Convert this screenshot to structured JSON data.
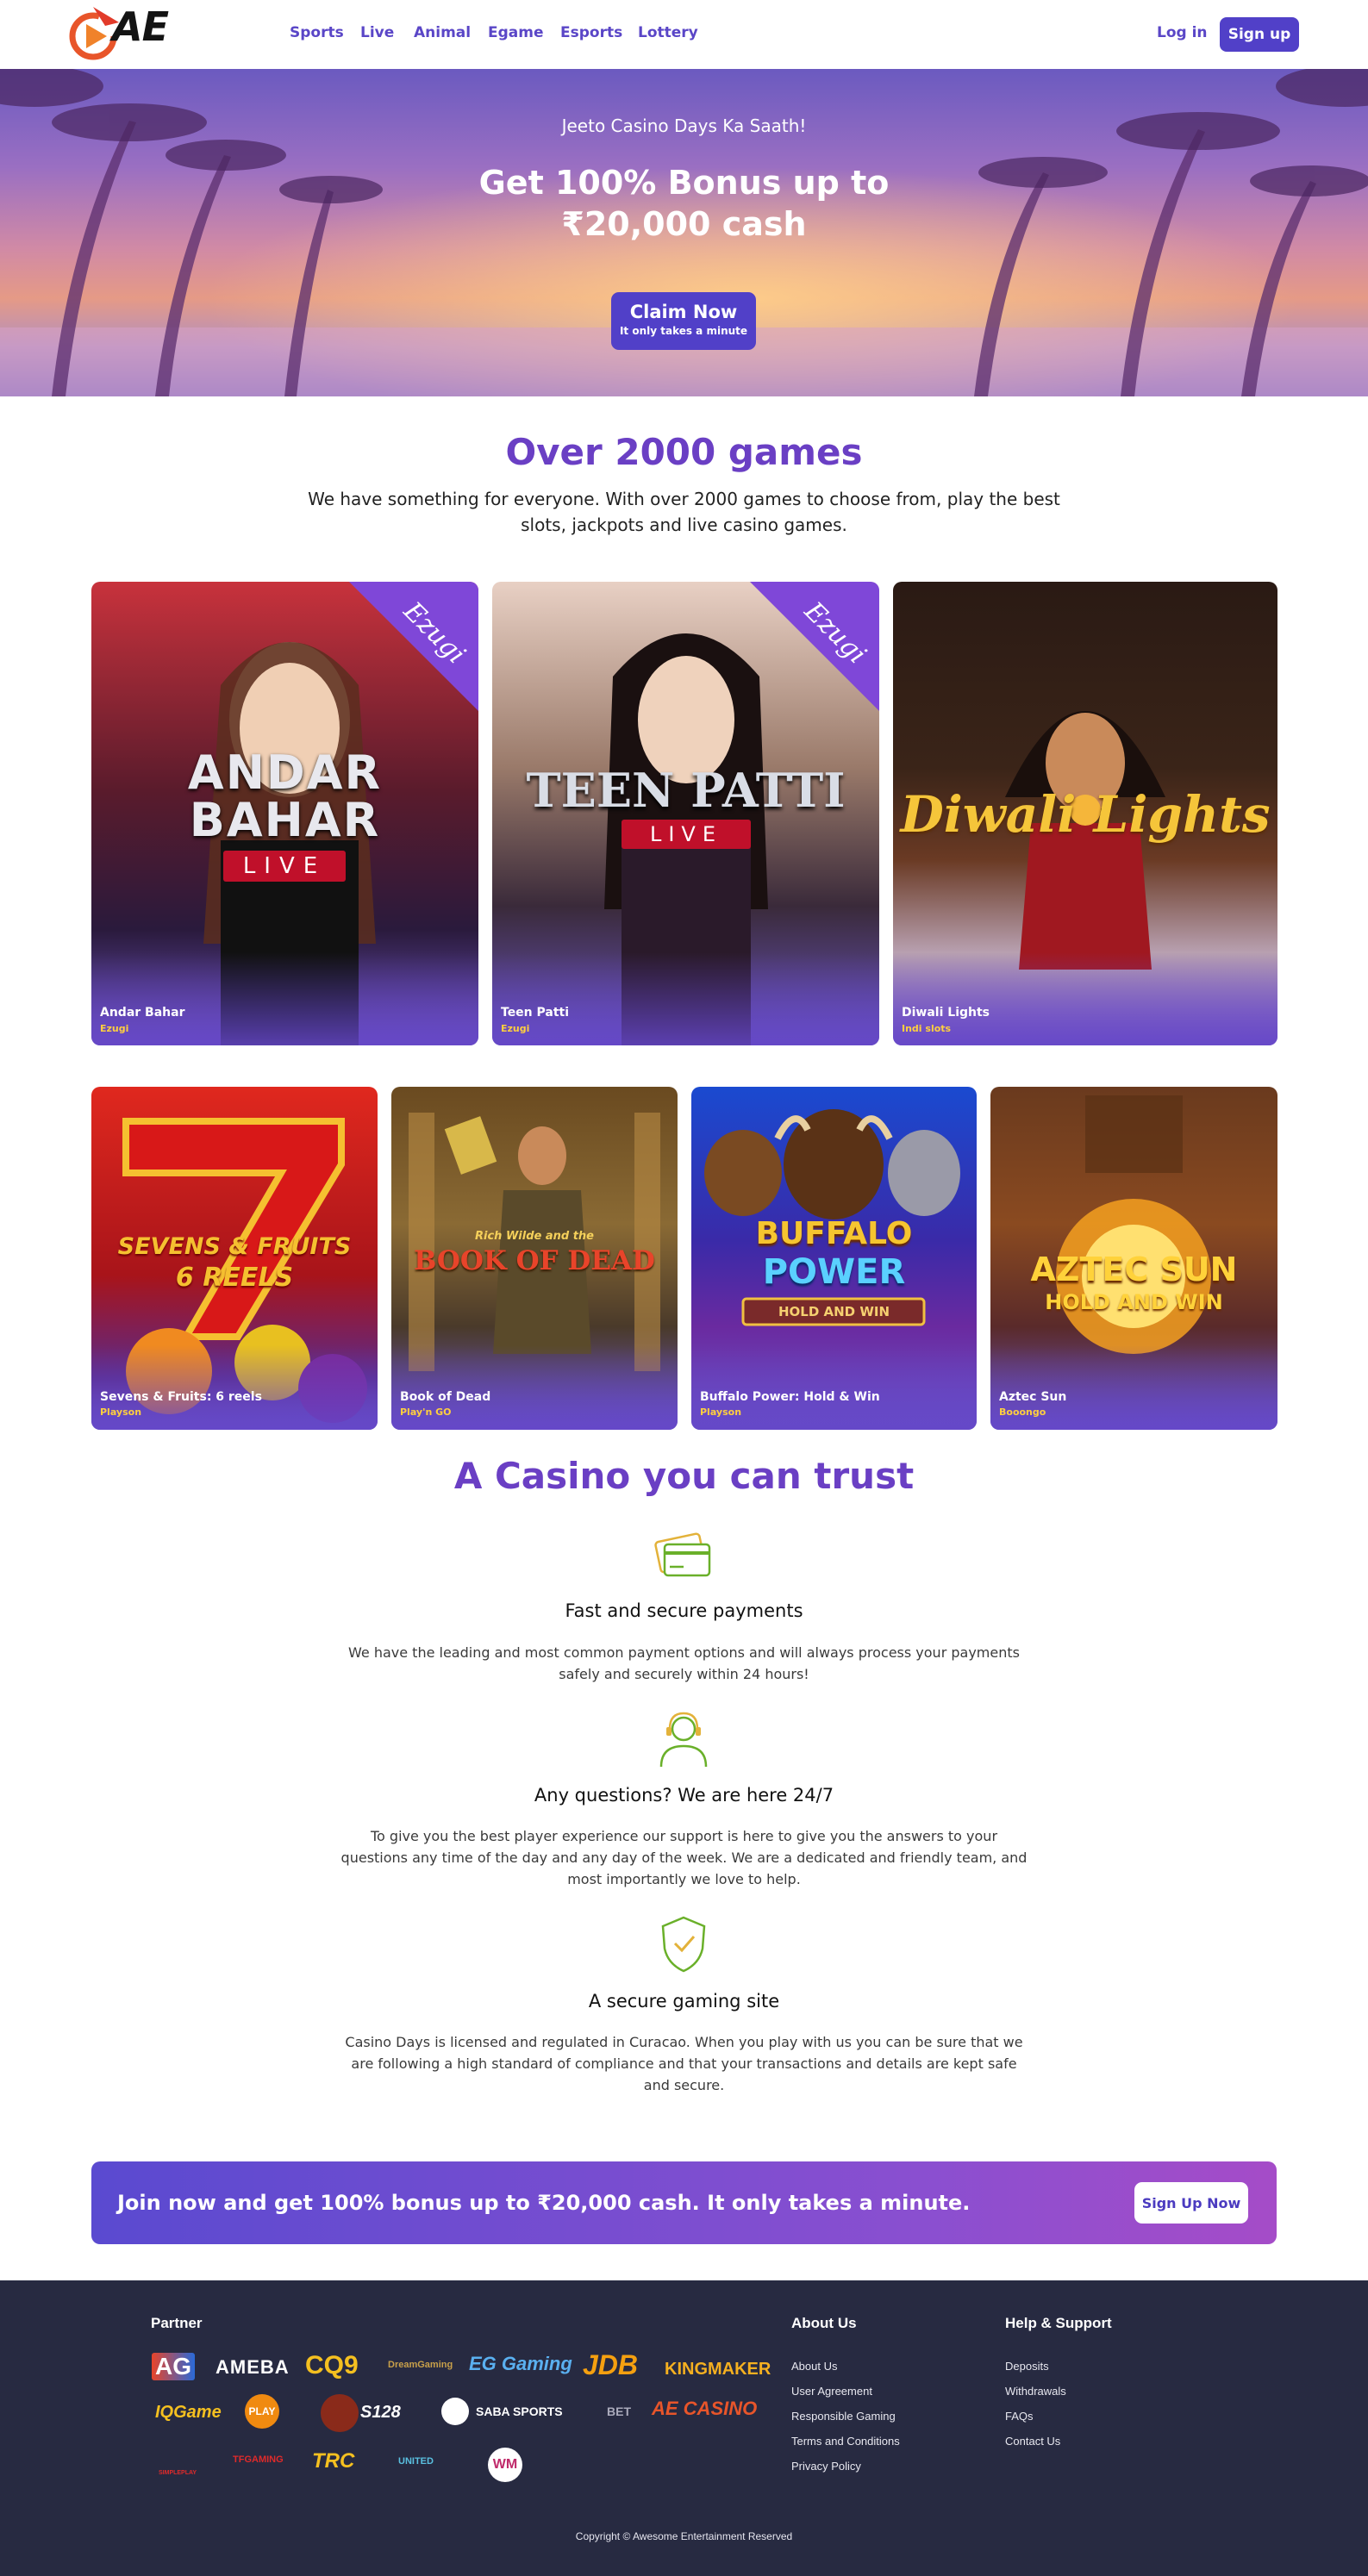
{
  "header": {
    "logo_text": "AE",
    "nav": [
      "Sports",
      "Live",
      "Animal",
      "Egame",
      "Esports",
      "Lottery"
    ],
    "login_label": "Log in",
    "signup_label": "Sign up"
  },
  "hero": {
    "subtitle": "Jeeto Casino Days Ka Saath!",
    "title_line1": "Get 100% Bonus up to",
    "title_line2": "₹20,000 cash",
    "claim_label": "Claim Now",
    "claim_sub": "It only takes a minute"
  },
  "games": {
    "title": "Over 2000 games",
    "description": "We have something for everyone. With over 2000 games to choose from, play the best slots, jackpots and live casino games.",
    "row1": [
      {
        "title": "Andar Bahar",
        "provider": "Ezugi",
        "art_line1": "ANDAR",
        "art_line2": "BAHAR",
        "art_tag": "LIVE",
        "badge": "Ezugi"
      },
      {
        "title": "Teen Patti",
        "provider": "Ezugi",
        "art_line1": "TEEN PATTI",
        "art_tag": "LIVE",
        "badge": "Ezugi"
      },
      {
        "title": "Diwali Lights",
        "provider": "Indi slots",
        "art_line1": "Diwali Lights"
      }
    ],
    "row2": [
      {
        "title": "Sevens & Fruits: 6 reels",
        "provider": "Playson",
        "art_line1": "SEVENS & FRUITS",
        "art_line2": "6 REELS"
      },
      {
        "title": "Book of Dead",
        "provider": "Play'n GO",
        "art_line1": "BOOK OF DEAD",
        "art_small": "Rich Wilde and the"
      },
      {
        "title": "Buffalo Power: Hold & Win",
        "provider": "Playson",
        "art_line1": "BUFFALO",
        "art_line2": "POWER",
        "art_tag": "HOLD AND WIN"
      },
      {
        "title": "Aztec Sun",
        "provider": "Booongo",
        "art_line1": "AZTEC SUN",
        "art_tag": "HOLD AND WIN"
      }
    ]
  },
  "trust": {
    "title": "A Casino you can trust",
    "items": [
      {
        "heading": "Fast and secure payments",
        "text": "We have the leading and most common payment options and will always process your payments safely and securely within 24 hours!",
        "icon": "credit-card-icon"
      },
      {
        "heading": "Any questions? We are here 24/7",
        "text": "To give you the best player experience our support is here to give you the answers to your questions any time of the day and any day of the week. We are a dedicated and friendly team, and most importantly we love to help.",
        "icon": "support-agent-icon"
      },
      {
        "heading": "A secure gaming site",
        "text": "Casino Days is licensed and regulated in Curacao. When you play with us you can be sure that we are following a high standard of compliance and that your transactions and details are kept safe and secure.",
        "icon": "shield-check-icon"
      }
    ]
  },
  "banner": {
    "text": "Join now and get 100% bonus up to ₹20,000 cash. It only takes a minute.",
    "button": "Sign Up Now"
  },
  "footer": {
    "partner_heading": "Partner",
    "partners": [
      "AG",
      "AMEBA",
      "CQ9",
      "DreamGaming",
      "EG Gaming",
      "JDB",
      "KINGMAKER",
      "IQGame",
      "PLAY",
      "S128",
      "SABA SPORTS",
      "BET",
      "AE CASINO",
      "SIMPLEPLAY",
      "TFGAMING",
      "TRC",
      "UNITED",
      "WM"
    ],
    "about_heading": "About Us",
    "about_links": [
      "About Us",
      "User Agreement",
      "Responsible Gaming",
      "Terms and Conditions",
      "Privacy Policy"
    ],
    "help_heading": "Help & Support",
    "help_links": [
      "Deposits",
      "Withdrawals",
      "FAQs",
      "Contact Us"
    ],
    "copyright": "Copyright © Awesome Entertainment Reserved"
  },
  "colors": {
    "accent": "#5140c8",
    "title_purple": "#6a3fc4",
    "footer_bg": "#272a41",
    "provider_yellow": "#ffcf3f"
  }
}
